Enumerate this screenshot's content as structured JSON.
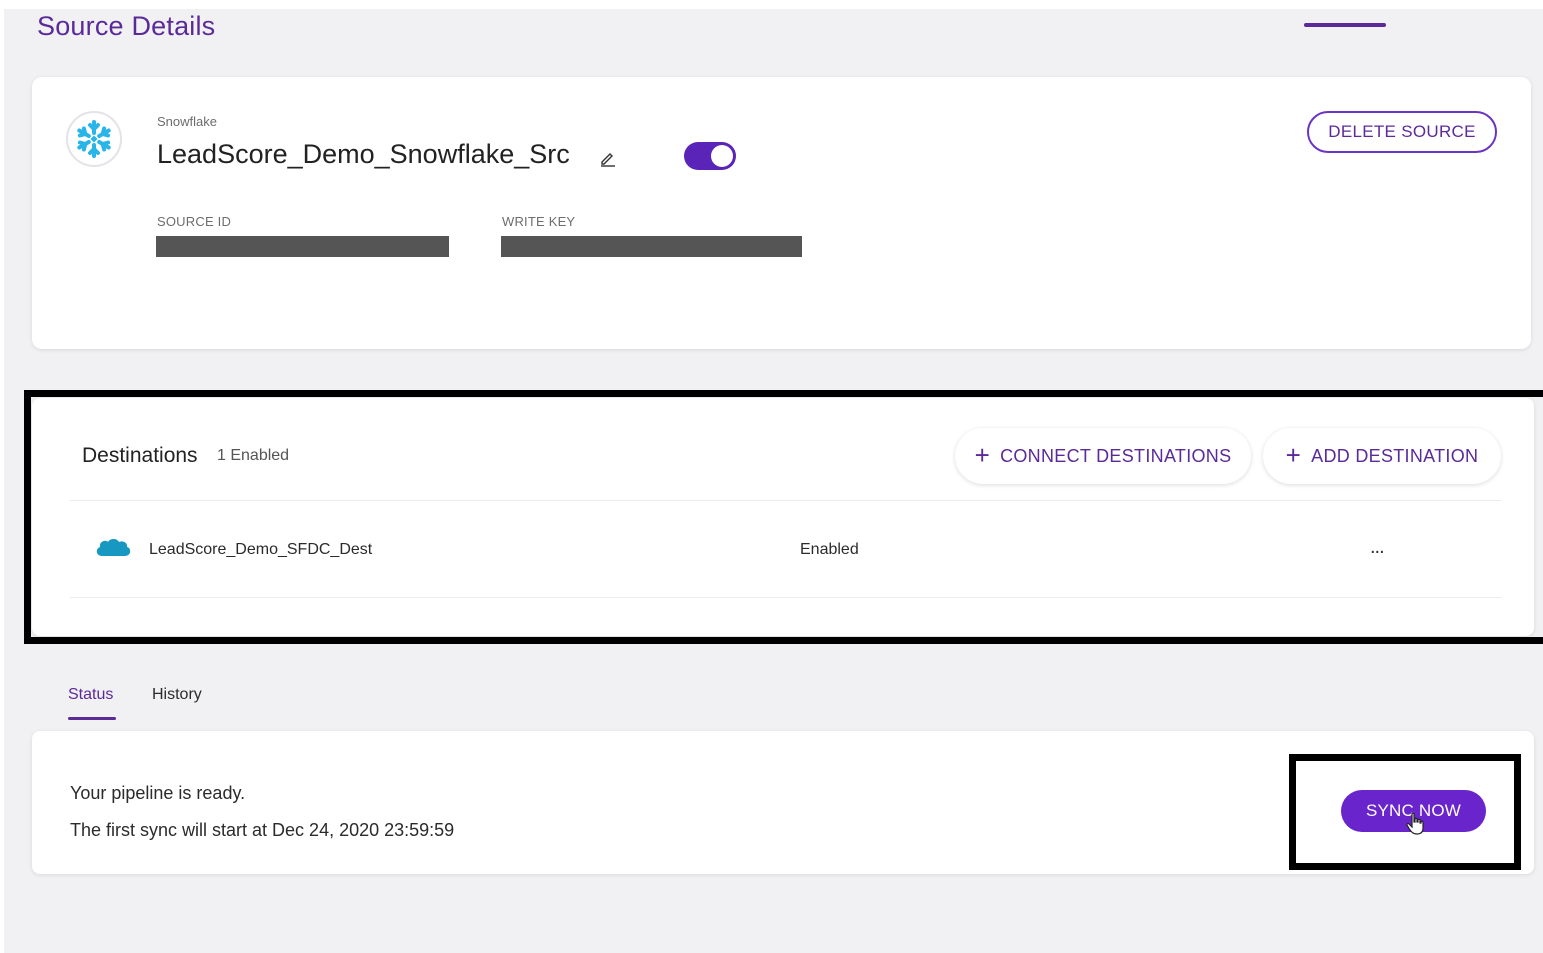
{
  "page": {
    "title": "Source Details"
  },
  "source": {
    "type": "Snowflake",
    "name": "LeadScore_Demo_Snowflake_Src",
    "enabled": true,
    "source_id_label": "SOURCE ID",
    "write_key_label": "WRITE KEY",
    "delete_label": "DELETE SOURCE",
    "logo_icon": "snowflake-icon",
    "edit_icon": "pencil-icon"
  },
  "destinations": {
    "title": "Destinations",
    "count_label": "1 Enabled",
    "connect_label": "CONNECT DESTINATIONS",
    "add_label": "ADD DESTINATION",
    "items": [
      {
        "name": "LeadScore_Demo_SFDC_Dest",
        "status": "Enabled",
        "icon": "salesforce-cloud-icon",
        "menu": "..."
      }
    ]
  },
  "tabs": {
    "status_label": "Status",
    "history_label": "History",
    "active": "status"
  },
  "status": {
    "line1": "Your pipeline is ready.",
    "line2": "The first sync will start at Dec 24, 2020 23:59:59",
    "sync_label": "SYNC NOW"
  },
  "colors": {
    "accent": "#5b2a99",
    "primary_button": "#6a24cc",
    "snowflake": "#29b5e8",
    "salesforce": "#1798c1"
  }
}
